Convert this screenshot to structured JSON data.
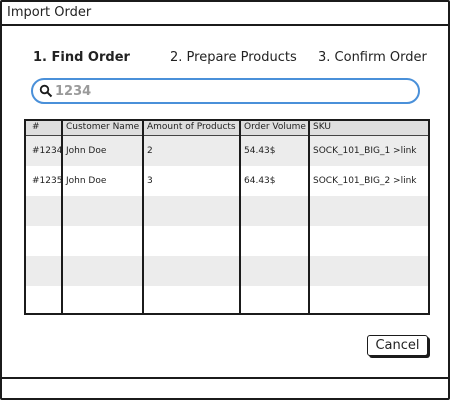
{
  "window": {
    "title": "Import Order"
  },
  "steps": [
    {
      "label": "1. Find Order"
    },
    {
      "label": "2. Prepare Products"
    },
    {
      "label": "3. Confirm Order"
    }
  ],
  "search": {
    "value": "1234",
    "icon": "search-icon"
  },
  "table": {
    "headers": [
      "#",
      "Customer Name",
      "Amount of Products",
      "Order Volume",
      "SKU"
    ],
    "rows": [
      [
        "#1234",
        "John Doe",
        "2",
        "54.43$",
        "SOCK_101_BIG_1 >link"
      ],
      [
        "#1235",
        "John Doe",
        "3",
        "64.43$",
        "SOCK_101_BIG_2 >link"
      ]
    ]
  },
  "buttons": {
    "cancel_label": "Cancel"
  }
}
